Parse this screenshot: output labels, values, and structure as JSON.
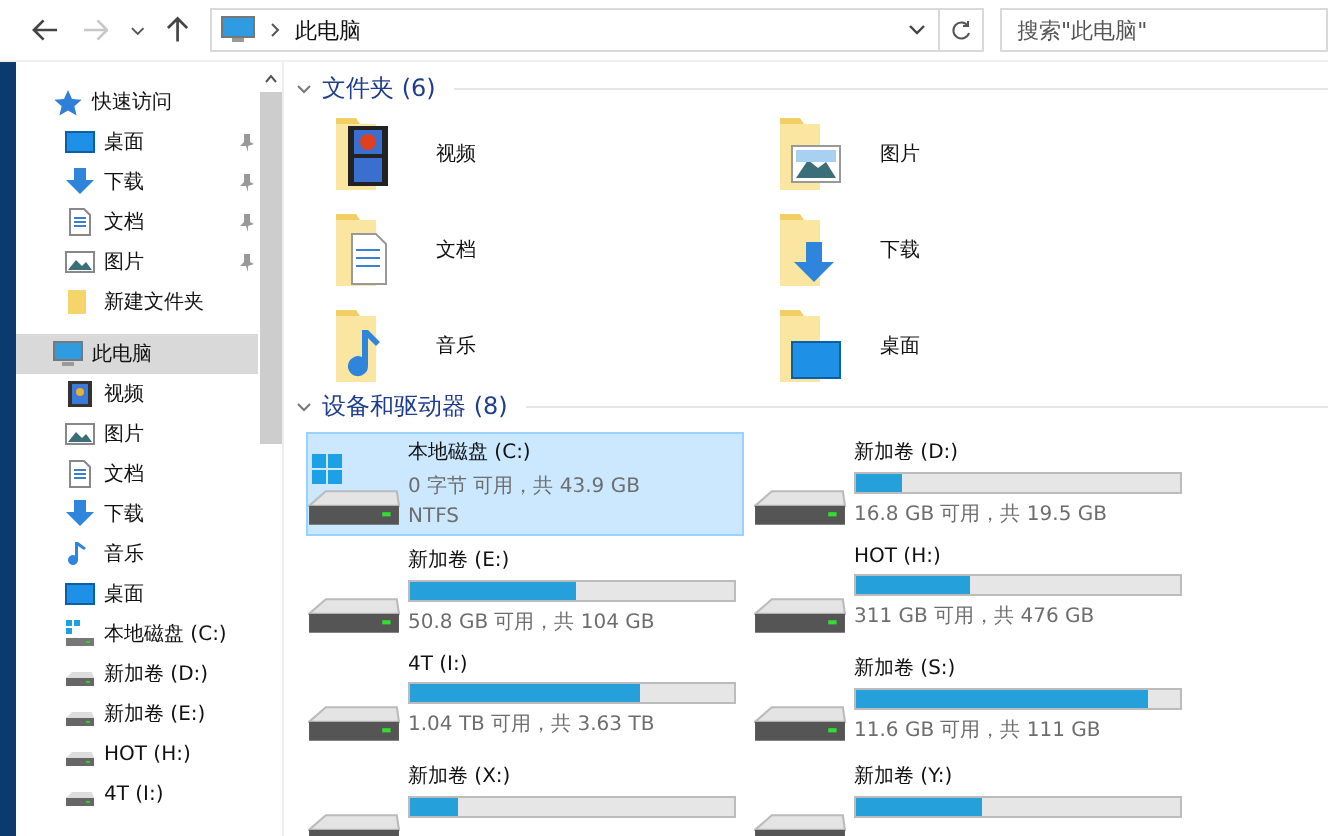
{
  "toolbar": {
    "forward_disabled": true,
    "address": "此电脑",
    "search": {
      "placeholder": "搜索\"此电脑\""
    }
  },
  "sidebar": {
    "items": [
      {
        "label": "快速访问",
        "kind": "star",
        "selected": false,
        "children": [
          {
            "label": "桌面",
            "kind": "desktop",
            "pinned": true,
            "selected": false
          },
          {
            "label": "下载",
            "kind": "download",
            "pinned": true,
            "selected": false
          },
          {
            "label": "文档",
            "kind": "document",
            "pinned": true,
            "selected": false
          },
          {
            "label": "图片",
            "kind": "picture",
            "pinned": true,
            "selected": false
          },
          {
            "label": "新建文件夹",
            "kind": "folder",
            "pinned": false,
            "selected": false
          }
        ]
      },
      {
        "label": "此电脑",
        "kind": "pc",
        "selected": true,
        "children": [
          {
            "label": "视频",
            "kind": "video",
            "selected": false
          },
          {
            "label": "图片",
            "kind": "picture",
            "selected": false
          },
          {
            "label": "文档",
            "kind": "document",
            "selected": false
          },
          {
            "label": "下载",
            "kind": "download",
            "selected": false
          },
          {
            "label": "音乐",
            "kind": "music",
            "selected": false
          },
          {
            "label": "桌面",
            "kind": "desktop",
            "selected": false
          },
          {
            "label": "本地磁盘 (C:)",
            "kind": "drive-windows",
            "selected": false
          },
          {
            "label": "新加卷 (D:)",
            "kind": "drive",
            "selected": false
          },
          {
            "label": "新加卷 (E:)",
            "kind": "drive",
            "selected": false
          },
          {
            "label": "HOT (H:)",
            "kind": "drive",
            "selected": false
          },
          {
            "label": "4T (I:)",
            "kind": "drive",
            "selected": false
          }
        ]
      }
    ]
  },
  "folders": {
    "heading": "文件夹 (6)",
    "items": [
      {
        "label": "视频",
        "kind": "video"
      },
      {
        "label": "图片",
        "kind": "picture"
      },
      {
        "label": "文档",
        "kind": "document"
      },
      {
        "label": "下载",
        "kind": "download"
      },
      {
        "label": "音乐",
        "kind": "music"
      },
      {
        "label": "桌面",
        "kind": "desktop"
      }
    ]
  },
  "devices": {
    "heading": "设备和驱动器 (8)",
    "items": [
      {
        "name": "本地磁盘 (C:)",
        "kind": "windows",
        "selected": true,
        "details": [
          "0 字节 可用，共 43.9 GB",
          "NTFS"
        ]
      },
      {
        "name": "新加卷 (D:)",
        "kind": "drive",
        "selected": false,
        "level": 0.14,
        "details": [
          "16.8 GB 可用，共 19.5 GB"
        ]
      },
      {
        "name": "新加卷 (E:)",
        "kind": "drive",
        "selected": false,
        "level": 0.51,
        "details": [
          "50.8 GB 可用，共 104 GB"
        ]
      },
      {
        "name": "HOT (H:)",
        "kind": "drive",
        "selected": false,
        "level": 0.35,
        "details": [
          "311 GB 可用，共 476 GB"
        ]
      },
      {
        "name": "4T (I:)",
        "kind": "drive",
        "selected": false,
        "level": 0.71,
        "details": [
          "1.04 TB 可用，共 3.63 TB"
        ]
      },
      {
        "name": "新加卷 (S:)",
        "kind": "drive",
        "selected": false,
        "level": 0.9,
        "details": [
          "11.6 GB 可用，共 111 GB"
        ]
      },
      {
        "name": "新加卷 (X:)",
        "kind": "drive",
        "selected": false,
        "level": 0.15
      },
      {
        "name": "新加卷 (Y:)",
        "kind": "drive",
        "selected": false,
        "level": 0.39
      }
    ]
  }
}
